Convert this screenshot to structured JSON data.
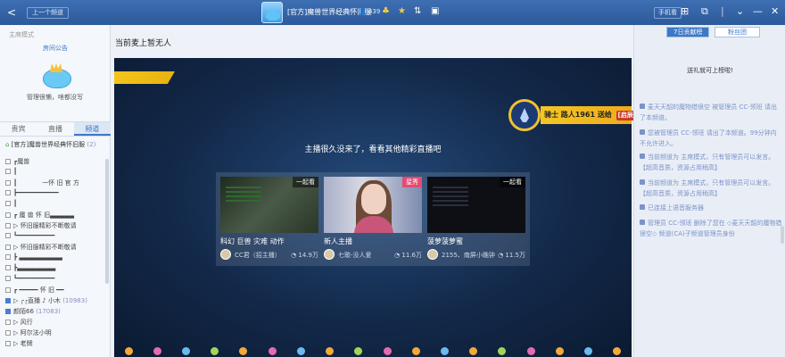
{
  "topbar": {
    "back": "<",
    "prev_channel": "上一个频道",
    "title": "[官方]魔兽世界经典怀旧服",
    "count": "639",
    "phone_button": "手机看",
    "menu_icons": [
      "grid-icon",
      "restore-icon",
      "chevron-down-icon",
      "minimize-icon",
      "close-icon"
    ]
  },
  "left": {
    "mode": "主席模式",
    "notice": "房间公告",
    "manager_text": "管理很懒，啥都没写",
    "tabs": [
      "贵宾",
      "直播",
      "频道"
    ],
    "active_tab": 2,
    "root_channel": {
      "name": "[官方]魔兽世界经典怀旧服",
      "count": "(2)"
    },
    "channels": [
      {
        "name": "┏魔兽",
        "count": ""
      },
      {
        "name": "┃",
        "count": ""
      },
      {
        "name": "┃　　　　一怀 旧 官 方",
        "count": ""
      },
      {
        "name": "┣━━━━━━━━━━━",
        "count": ""
      },
      {
        "name": "┃",
        "count": ""
      },
      {
        "name": "┏ 魔 兽 怀 旧▃▃▃▃▃",
        "count": ""
      },
      {
        "name": "▷ 怀旧服精彩不断敬请",
        "count": ""
      },
      {
        "name": "┗━━━━━━━━━━",
        "count": ""
      },
      {
        "name": "▷ 怀旧服精彩不断敬请",
        "count": ""
      },
      {
        "name": "┣ ▃▃▃▃▃▃▃▃▃",
        "count": ""
      },
      {
        "name": "┣▃▃▃▃▃▃▃▃",
        "count": ""
      },
      {
        "name": "┗━━━━━━━━━━",
        "count": ""
      },
      {
        "name": "┏ ━━━━━ 怀 旧 ━━",
        "count": ""
      },
      {
        "name": "▷ ┌┌直播 ♪ 小木",
        "count": "(10983)"
      },
      {
        "name": "颜陌66",
        "count": "(17083)"
      },
      {
        "name": "▷ 风行",
        "count": ""
      },
      {
        "name": "▷ 阿尔法小明",
        "count": ""
      },
      {
        "name": "▷ 老牌",
        "count": ""
      }
    ]
  },
  "main": {
    "no_mic": "当前麦上暂无人",
    "knight": {
      "text": "骑士 路人1961 送给 ",
      "badge": "[启辰]"
    },
    "video_msg": "主播很久没来了，看看其他精彩直播吧",
    "cards": [
      {
        "tag": "一起看",
        "name": "科幻 巨兽 灾难 动作",
        "user": "CC君（招主播）",
        "views": "14.9万"
      },
      {
        "tag": "星秀",
        "name": "新人主播",
        "user": "七歌-没人爱",
        "views": "11.6万"
      },
      {
        "tag": "一起看",
        "name": "菠萝菠萝蜜",
        "user": "2155、南屏小晚钟",
        "views": "11.5万"
      }
    ]
  },
  "right": {
    "tabs": [
      "7日贡献榜",
      "粉丝团"
    ],
    "gift_text": "送礼就可上榜啦!",
    "messages": [
      "麦天天韶的魔物猎很空 被管理员 CC-领班 请出了本频道。",
      "您被管理员 CC-领班 请出了本频道。99分钟内不允许进入。",
      "当前频道为 主席模式，只有管理员可以发言。【超高音质，资源占用稍高】",
      "当前频道为 主席模式，只有管理员可以发言。【超高音质，资源占用稍高】",
      "已连接上语音服务器",
      "管理员 CC-领班 删除了您在 ◇麦天天韶的魔物猎很空◇ 频道(CA)子频道管理员身份"
    ]
  }
}
